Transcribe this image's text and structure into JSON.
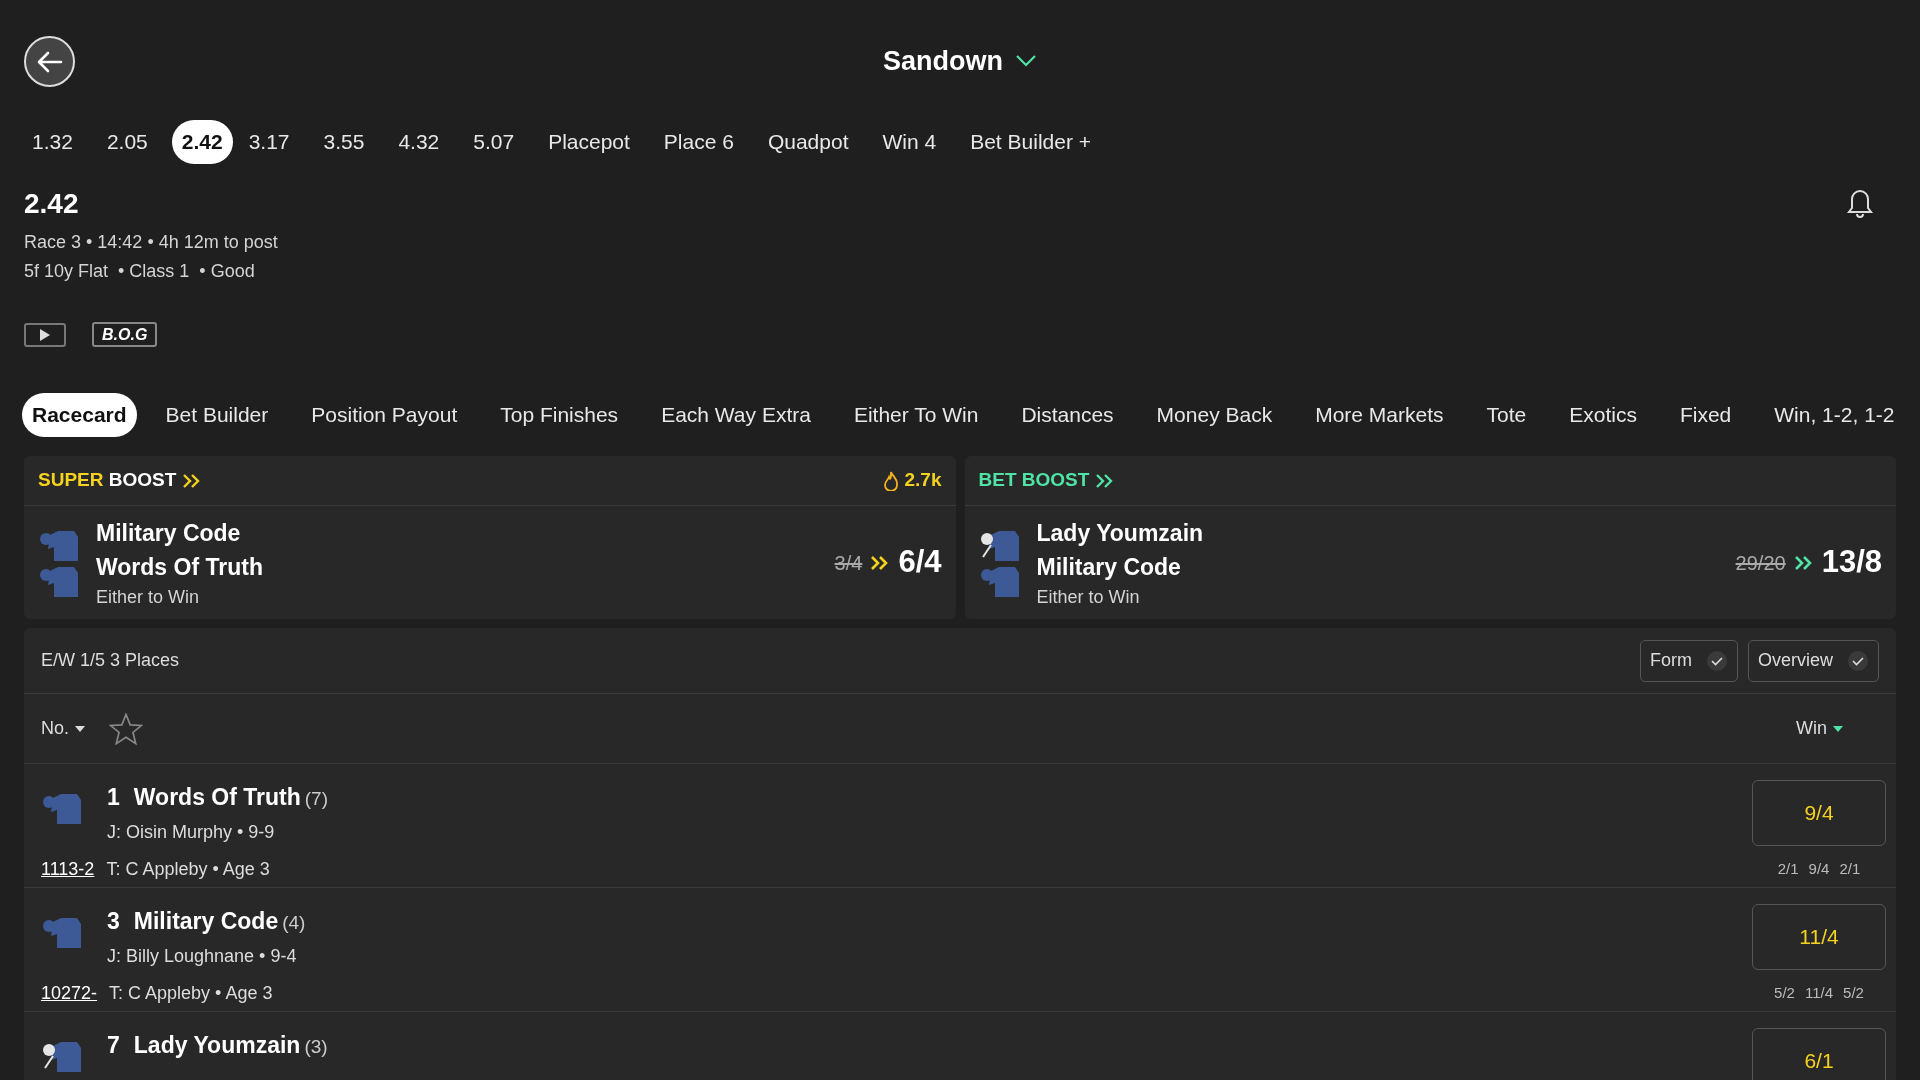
{
  "header": {
    "title": "Sandown"
  },
  "race_tabs": [
    {
      "label": "1.32",
      "selected": false
    },
    {
      "label": "2.05",
      "selected": false
    },
    {
      "label": "2.42",
      "selected": true
    },
    {
      "label": "3.17",
      "selected": false
    },
    {
      "label": "3.55",
      "selected": false
    },
    {
      "label": "4.32",
      "selected": false
    },
    {
      "label": "5.07",
      "selected": false
    },
    {
      "label": "Placepot",
      "selected": false
    },
    {
      "label": "Place 6",
      "selected": false
    },
    {
      "label": "Quadpot",
      "selected": false
    },
    {
      "label": "Win 4",
      "selected": false
    },
    {
      "label": "Bet Builder +",
      "selected": false
    }
  ],
  "race": {
    "title": "2.42",
    "line_1": "Race 3 • 14:42 • 4h 12m to post",
    "line_2": "5f 10y Flat  • Class 1  • Good",
    "badge": "B.O.G"
  },
  "market_tabs": [
    {
      "label": "Racecard",
      "selected": true
    },
    {
      "label": "Bet Builder",
      "selected": false
    },
    {
      "label": "Position Payout",
      "selected": false
    },
    {
      "label": "Top Finishes",
      "selected": false
    },
    {
      "label": "Each Way Extra",
      "selected": false
    },
    {
      "label": "Either To Win",
      "selected": false
    },
    {
      "label": "Distances",
      "selected": false
    },
    {
      "label": "Money Back",
      "selected": false
    },
    {
      "label": "More Markets",
      "selected": false
    },
    {
      "label": "Tote",
      "selected": false
    },
    {
      "label": "Exotics",
      "selected": false
    },
    {
      "label": "Fixed",
      "selected": false
    },
    {
      "label": "Win, 1-2, 1-2",
      "selected": false
    }
  ],
  "boosts": [
    {
      "kind": "super",
      "title": [
        "SUPER",
        "BOOST"
      ],
      "popularity": "2.7k",
      "selections": [
        {
          "name": "Military Code",
          "kind": "plain"
        },
        {
          "name": "Words Of Truth",
          "kind": "plain"
        }
      ],
      "market": "Either to Win",
      "was": "3/4",
      "now": "6/4"
    },
    {
      "kind": "bet",
      "title": [
        "BET",
        "BOOST"
      ],
      "selections": [
        {
          "name": "Lady Youmzain",
          "kind": "white-cap"
        },
        {
          "name": "Military Code",
          "kind": "plain"
        }
      ],
      "market": "Either to Win",
      "was": "29/20",
      "now": "13/8"
    }
  ],
  "racecard": {
    "terms": "E/W 1/5 3 Places",
    "toggles": [
      {
        "label": "Form",
        "checked": true
      },
      {
        "label": "Overview",
        "checked": true
      }
    ],
    "sort_label": "No.",
    "price_label": "Win",
    "runners": [
      {
        "number": "1",
        "name": "Words Of Truth",
        "draw": "(7)",
        "jockey": "J: Oisin Murphy • 9-9",
        "form": "1113-2",
        "trainer": "T: C Appleby • Age 3",
        "odds": "9/4",
        "history": [
          "2/1",
          "9/4",
          "2/1"
        ],
        "kind": "plain"
      },
      {
        "number": "3",
        "name": "Military Code",
        "draw": "(4)",
        "jockey": "J: Billy Loughnane • 9-4",
        "form": "10272-",
        "trainer": "T: C Appleby • Age 3",
        "odds": "11/4",
        "history": [
          "5/2",
          "11/4",
          "5/2"
        ],
        "kind": "plain"
      },
      {
        "number": "7",
        "name": "Lady Youmzain",
        "draw": "(3)",
        "odds": "6/1",
        "kind": "white-cap"
      }
    ]
  }
}
